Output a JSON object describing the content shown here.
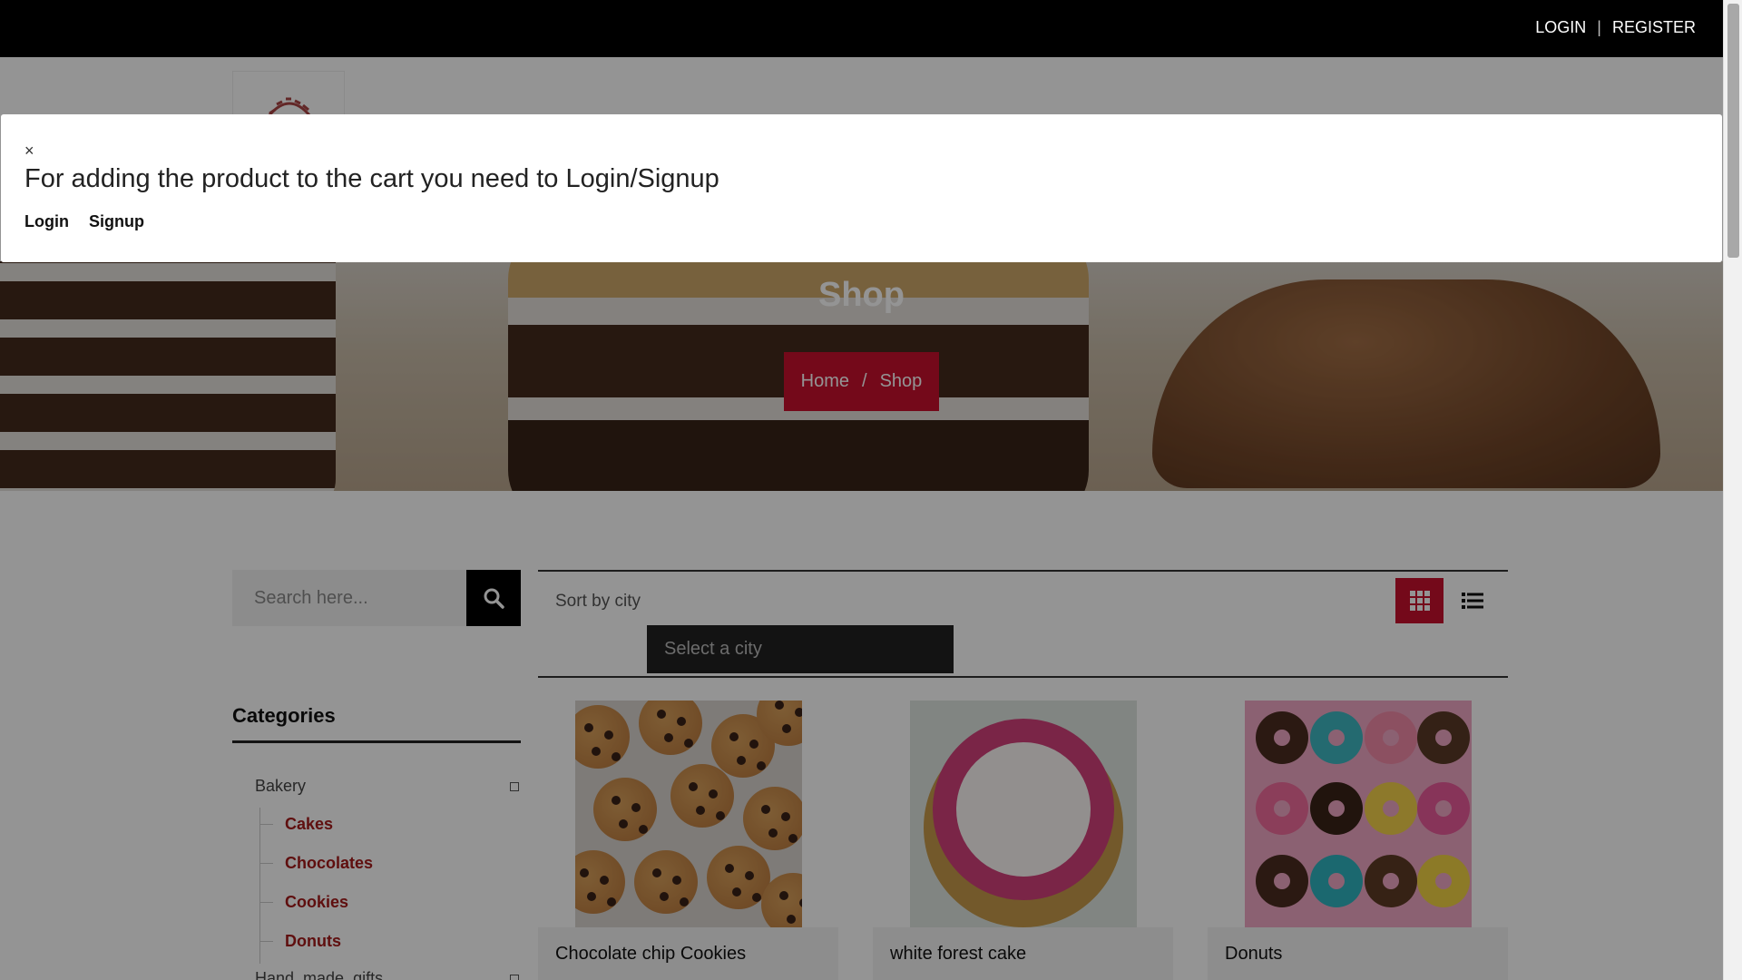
{
  "topbar": {
    "login": "LOGIN",
    "separator": "|",
    "register": "REGISTER"
  },
  "hero": {
    "title": "Shop",
    "breadcrumb_home": "Home",
    "breadcrumb_sep": "/",
    "breadcrumb_current": "Shop"
  },
  "search": {
    "placeholder": "Search here..."
  },
  "toolbar": {
    "sort_label": "Sort by city",
    "city_placeholder": "Select a city"
  },
  "categories": {
    "title": "Categories",
    "parents": [
      {
        "label": "Bakery",
        "children": [
          "Cakes",
          "Chocolates",
          "Cookies",
          "Donuts"
        ]
      },
      {
        "label": "Hand_made_gifts"
      }
    ]
  },
  "products": [
    {
      "title": "Chocolate chip Cookies"
    },
    {
      "title": "white forest cake"
    },
    {
      "title": "Donuts"
    }
  ],
  "modal": {
    "close": "×",
    "message": "For adding the product to the cart you need to Login/Signup",
    "login": "Login",
    "signup": "Signup"
  },
  "colors": {
    "accent": "#c8102e",
    "topbar": "#000000",
    "category_link": "#a41a1a"
  },
  "icons": [
    "search-icon",
    "grid-view-icon",
    "list-view-icon",
    "close-icon",
    "collapse-icon"
  ]
}
